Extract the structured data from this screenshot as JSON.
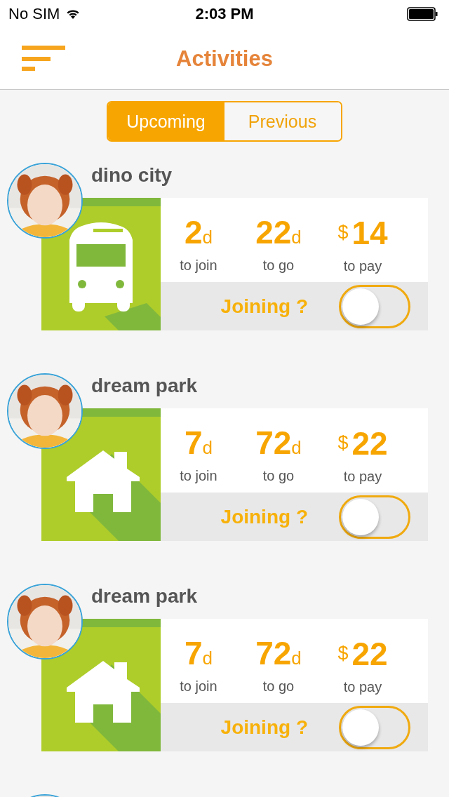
{
  "status_bar": {
    "carrier": "No SIM",
    "time": "2:03 PM"
  },
  "nav_bar": {
    "title": "Activities"
  },
  "tabs": [
    {
      "label": "Upcoming",
      "selected": true
    },
    {
      "label": "Previous",
      "selected": false
    }
  ],
  "activities": [
    {
      "avatar": {
        "kind": "picture"
      },
      "name": "dino city",
      "kind": "bus",
      "join": "2",
      "join_unit": "d",
      "join_label": "to join",
      "go": "22",
      "go_unit": "d",
      "go_label": "to go",
      "currency": "$",
      "pay": "14",
      "pay_label": "to pay",
      "prompt": "Joining ?",
      "joining": false
    },
    {
      "avatar": {
        "kind": "picture"
      },
      "name": "dream park",
      "kind": "house",
      "join": "7",
      "join_unit": "d",
      "join_label": "to join",
      "go": "72",
      "go_unit": "d",
      "go_label": "to go",
      "currency": "$",
      "pay": "22",
      "pay_label": "to pay",
      "prompt": "Joining ?",
      "joining": false
    },
    {
      "avatar": {
        "kind": "picture"
      },
      "name": "dream park",
      "kind": "house",
      "join": "7",
      "join_unit": "d",
      "join_label": "to join",
      "go": "72",
      "go_unit": "d",
      "go_label": "to go",
      "currency": "$",
      "pay": "22",
      "pay_label": "to pay",
      "prompt": "Joining ?",
      "joining": false
    },
    {
      "avatar": {
        "kind": "picture"
      }
    }
  ]
}
